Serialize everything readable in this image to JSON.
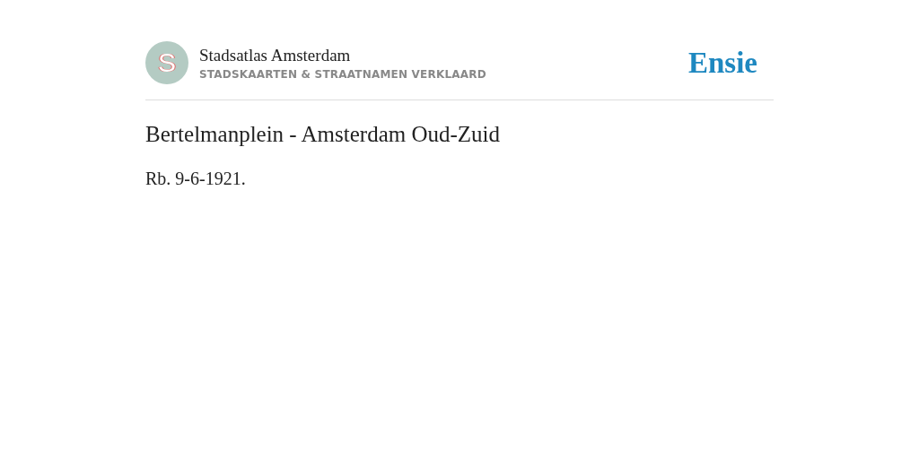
{
  "header": {
    "logo_letter": "S",
    "site_title": "Stadsatlas Amsterdam",
    "tagline": "STADSKAARTEN & STRAATNAMEN VERKLAARD",
    "brand": "Ensie"
  },
  "article": {
    "title": "Bertelmanplein - Amsterdam Oud-Zuid",
    "body": "Rb. 9-6-1921."
  }
}
